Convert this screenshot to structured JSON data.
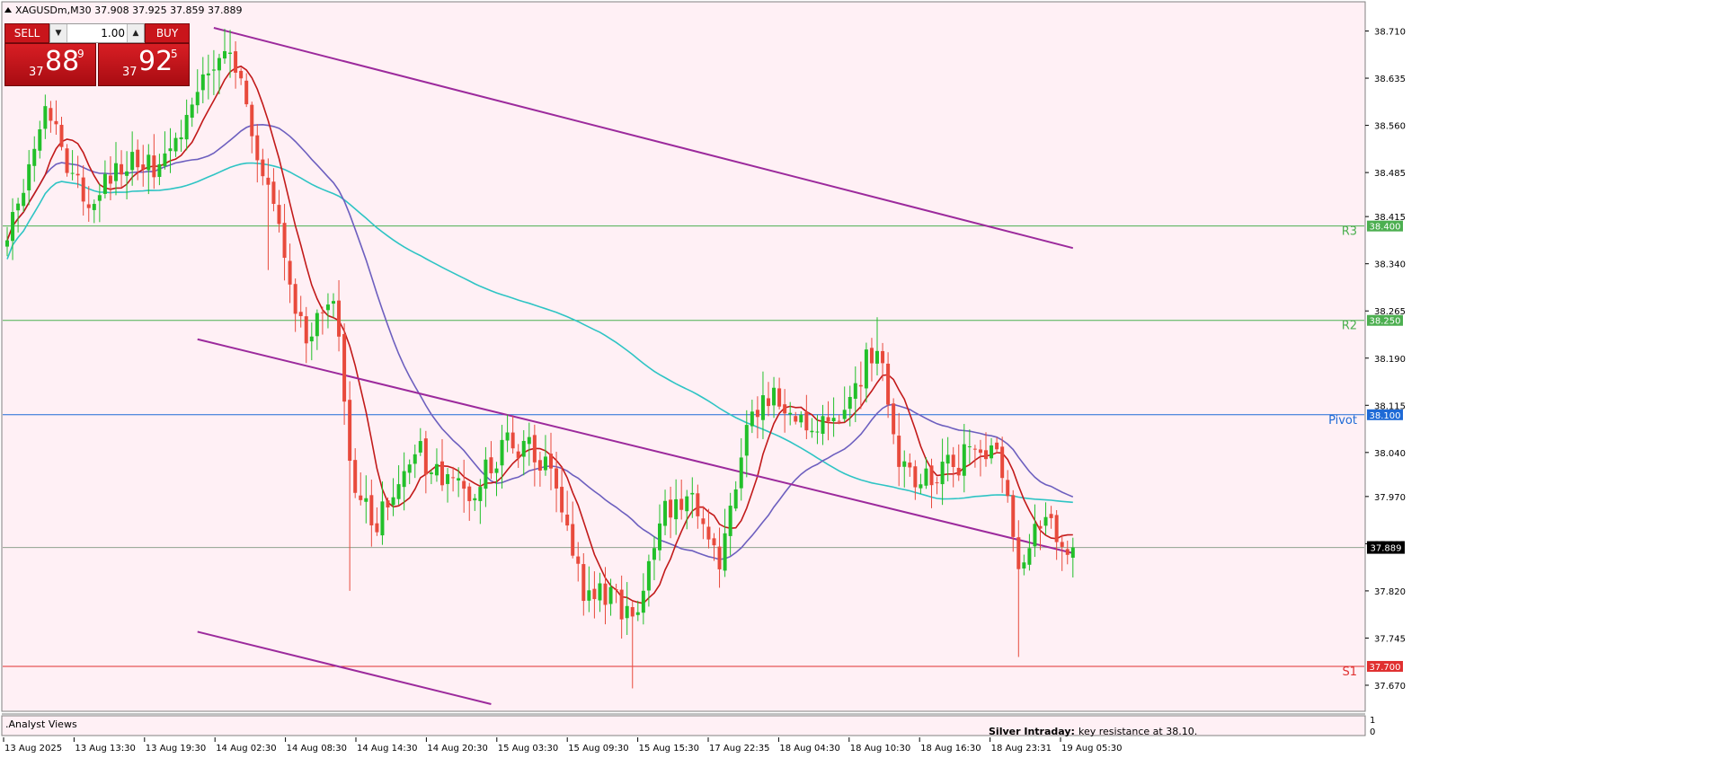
{
  "header": {
    "symbol_info": "XAGUSDm,M30  37.908 37.925 37.859 37.889"
  },
  "trade_panel": {
    "sell_label": "SELL",
    "buy_label": "BUY",
    "lot": "1.00",
    "sell_prefix": "37",
    "sell_big": "88",
    "sell_sup": "9",
    "buy_prefix": "37",
    "buy_big": "92",
    "buy_sup": "5"
  },
  "footer": {
    "indicator_label": ".Analyst Views",
    "sub_axis_top": "1",
    "sub_axis_bottom": "0",
    "analyst_title": "Silver Intraday:",
    "analyst_text": "key resistance at 38.10."
  },
  "colors": {
    "background": "#fff0f5",
    "bull": "#22c02a",
    "bear": "#e84a3c",
    "ma_fast": "#c21a1a",
    "ma_mid": "#6d5fbf",
    "ma_slow": "#2ec4c4",
    "channel": "#9c2a9c",
    "r_levels": "#4caf50",
    "pivot": "#1e6ad6",
    "s1": "#e03030"
  },
  "chart_data": {
    "type": "candlestick",
    "symbol": "XAGUSDm",
    "timeframe": "M30",
    "ylim": [
      37.63,
      38.755
    ],
    "y_ticks": [
      38.71,
      38.635,
      38.56,
      38.485,
      38.415,
      38.34,
      38.265,
      38.19,
      38.115,
      38.04,
      37.97,
      37.895,
      37.82,
      37.745,
      37.67
    ],
    "x_tick_labels": [
      "13 Aug 2025",
      "13 Aug 13:30",
      "13 Aug 19:30",
      "14 Aug 02:30",
      "14 Aug 08:30",
      "14 Aug 14:30",
      "14 Aug 20:30",
      "15 Aug 03:30",
      "15 Aug 09:30",
      "15 Aug 15:30",
      "17 Aug 22:35",
      "18 Aug 04:30",
      "18 Aug 10:30",
      "18 Aug 16:30",
      "18 Aug 23:31",
      "19 Aug 05:30"
    ],
    "candle_count": 197,
    "last_price": 37.889,
    "last_price_label": "37.889",
    "levels": [
      {
        "name": "R3",
        "value": 38.4,
        "label": "38.400"
      },
      {
        "name": "R2",
        "value": 38.25,
        "label": "38.250"
      },
      {
        "name": "Pivot",
        "value": 38.1,
        "label": "38.100"
      },
      {
        "name": "S1",
        "value": 37.7,
        "label": "37.700"
      }
    ],
    "key_points": [
      {
        "bar": 0,
        "close": 38.38
      },
      {
        "bar": 7,
        "close": 38.58
      },
      {
        "bar": 14,
        "close": 38.44
      },
      {
        "bar": 22,
        "close": 38.5
      },
      {
        "bar": 30,
        "close": 38.5
      },
      {
        "bar": 37,
        "close": 38.66
      },
      {
        "bar": 40,
        "close": 38.7
      },
      {
        "bar": 45,
        "close": 38.56
      },
      {
        "bar": 50,
        "close": 38.38
      },
      {
        "bar": 55,
        "close": 38.22
      },
      {
        "bar": 60,
        "close": 38.3
      },
      {
        "bar": 63,
        "close": 38.02
      },
      {
        "bar": 68,
        "close": 37.92
      },
      {
        "bar": 75,
        "close": 38.04
      },
      {
        "bar": 85,
        "close": 37.98
      },
      {
        "bar": 92,
        "close": 38.06
      },
      {
        "bar": 100,
        "close": 38.02
      },
      {
        "bar": 106,
        "close": 37.82
      },
      {
        "bar": 112,
        "close": 37.8
      },
      {
        "bar": 116,
        "close": 37.77
      },
      {
        "bar": 120,
        "close": 37.94
      },
      {
        "bar": 127,
        "close": 37.96
      },
      {
        "bar": 131,
        "close": 37.86
      },
      {
        "bar": 136,
        "close": 38.07
      },
      {
        "bar": 141,
        "close": 38.15
      },
      {
        "bar": 147,
        "close": 38.06
      },
      {
        "bar": 154,
        "close": 38.1
      },
      {
        "bar": 160,
        "close": 38.22
      },
      {
        "bar": 163,
        "close": 38.05
      },
      {
        "bar": 168,
        "close": 37.99
      },
      {
        "bar": 176,
        "close": 38.03
      },
      {
        "bar": 182,
        "close": 38.05
      },
      {
        "bar": 186,
        "close": 37.86
      },
      {
        "bar": 191,
        "close": 37.93
      },
      {
        "bar": 196,
        "close": 37.889
      }
    ],
    "channel_lines": [
      {
        "from": {
          "bar": 38,
          "y": 38.715
        },
        "to": {
          "bar": 196,
          "y": 38.365
        }
      },
      {
        "from": {
          "bar": 35,
          "y": 38.22
        },
        "to": {
          "bar": 196,
          "y": 37.88
        }
      },
      {
        "from": {
          "bar": 35,
          "y": 37.755
        },
        "to": {
          "bar": 89,
          "y": 37.64
        }
      }
    ]
  }
}
